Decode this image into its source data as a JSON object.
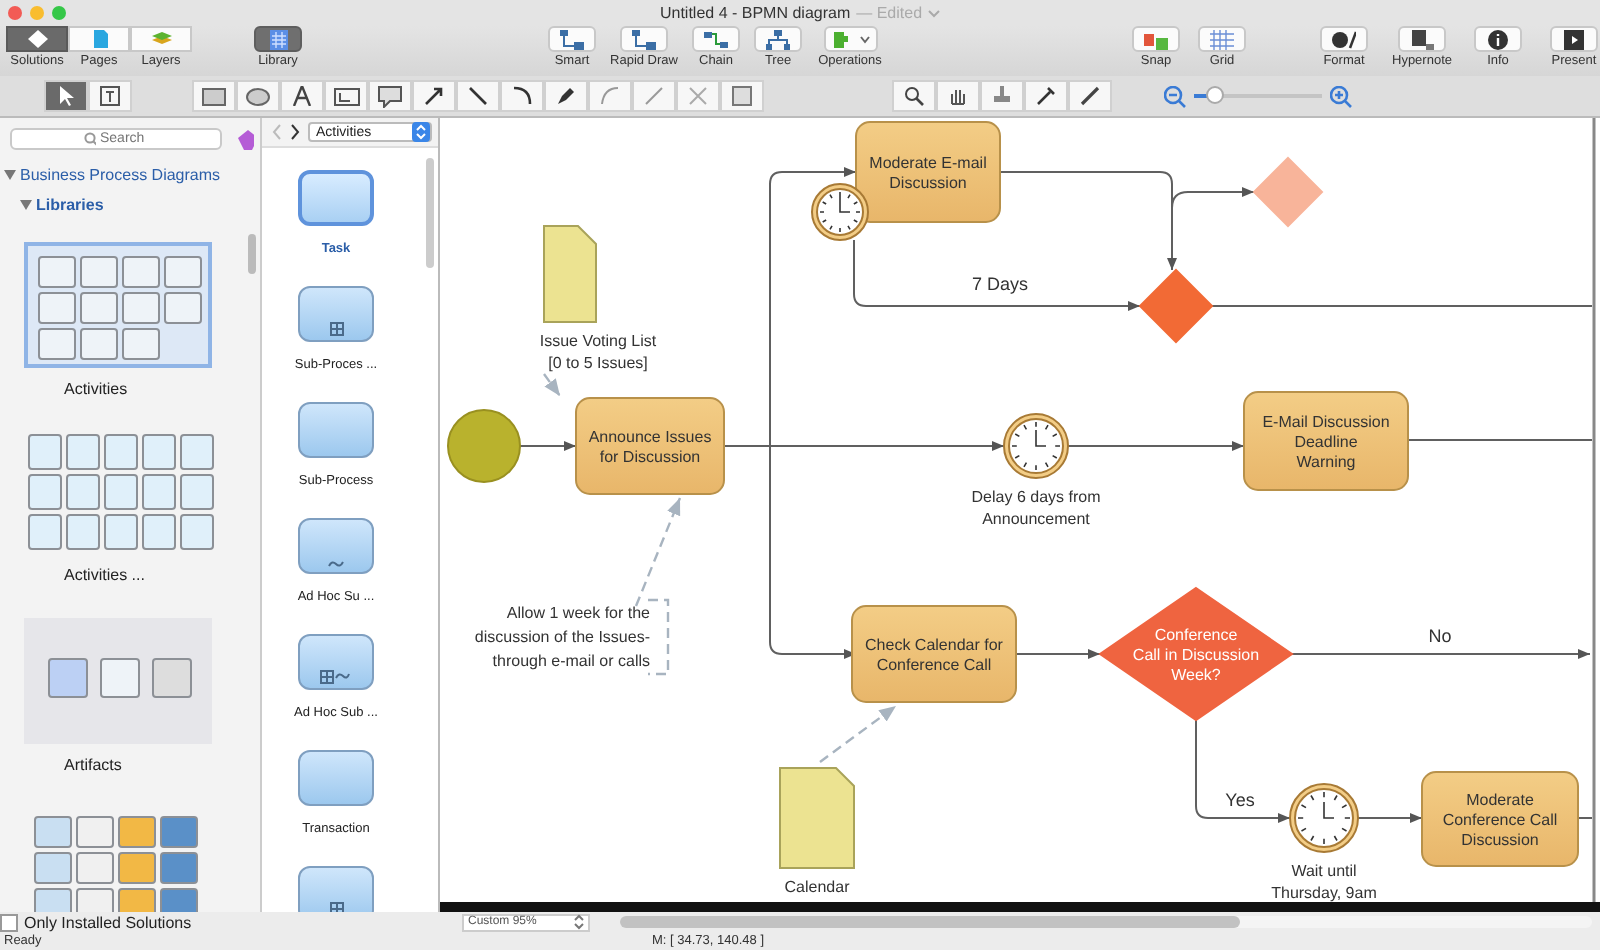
{
  "window": {
    "title": "Untitled 4 - BPMN diagram",
    "status": "— Edited"
  },
  "toolbar": {
    "view_tabs": [
      {
        "label": "Solutions",
        "selected": true
      },
      {
        "label": "Pages",
        "selected": false
      },
      {
        "label": "Layers",
        "selected": false
      }
    ],
    "library": {
      "label": "Library",
      "selected": true
    },
    "groups": [
      [
        {
          "label": "Smart"
        },
        {
          "label": "Rapid Draw"
        },
        {
          "label": "Chain"
        },
        {
          "label": "Tree"
        },
        {
          "label": "Operations",
          "menu": true
        }
      ],
      [
        {
          "label": "Snap"
        },
        {
          "label": "Grid"
        }
      ],
      [
        {
          "label": "Format"
        },
        {
          "label": "Hypernote"
        },
        {
          "label": "Info"
        },
        {
          "label": "Present"
        }
      ]
    ]
  },
  "tools": [
    {
      "kind": "pointer",
      "selected": true
    },
    {
      "kind": "text",
      "selected": false
    }
  ],
  "zoom_slider": {
    "level": 0.15
  },
  "sidebar": {
    "search": {
      "placeholder": "Search"
    },
    "tree": {
      "label": "Business Process Diagrams",
      "expanded": true,
      "children": [
        {
          "label": "Libraries",
          "expanded": true
        }
      ]
    },
    "libraries": [
      {
        "label": "Activities",
        "kind": "activities",
        "selected": true
      },
      {
        "label": "Activities ...",
        "kind": "activities2",
        "selected": false
      },
      {
        "label": "Artifacts",
        "kind": "artifacts",
        "selected": false
      },
      {
        "kind": "gallery",
        "selected": false
      }
    ],
    "only_installed": {
      "label": "Only Installed Solutions",
      "checked": false
    }
  },
  "library_panel": {
    "dropdown": "Activities",
    "shapes": [
      {
        "label": "Task",
        "kind": "plain",
        "selected": true
      },
      {
        "label": "Sub-Proces ...",
        "kind": "subprocess",
        "selected": false
      },
      {
        "label": "Sub-Process",
        "kind": "plain",
        "selected": false
      },
      {
        "label": "Ad Hoc Su ...",
        "kind": "adhoc",
        "selected": false
      },
      {
        "label": "Ad Hoc Sub ...",
        "kind": "adhoc-subprocess",
        "selected": false
      },
      {
        "label": "Transaction",
        "kind": "plain",
        "selected": false
      },
      {
        "kind": "subprocess",
        "selected": false
      }
    ]
  },
  "diagram": {
    "tasks": [
      {
        "label": "Moderate E-mail\nDiscussion",
        "boundary_timer": true
      },
      {
        "label": "Announce Issues\nfor Discussion",
        "boundary_timer": false
      },
      {
        "label": "E-Mail Discussion\nDeadline\nWarning",
        "boundary_timer": false
      },
      {
        "label": "Check Calendar for\nConference Call",
        "boundary_timer": false
      },
      {
        "label": "Moderate\nConference Call\nDiscussion",
        "boundary_timer": false
      }
    ],
    "timers": [
      {
        "label": "Delay 6 days from\nAnnouncement"
      },
      {
        "label": "Wait until\nThursday, 9am"
      }
    ],
    "documents": [
      {
        "label": "Issue Voting List\n[0 to 5 Issues]"
      },
      {
        "label": "Calendar"
      }
    ],
    "gateways": [
      {
        "color": "#f26a35"
      },
      {
        "color": "#f8b49a"
      },
      {
        "color": "#ef6440",
        "label": "Conference\nCall in Discussion\nWeek?"
      }
    ],
    "annotation": "Allow 1 week for the\ndiscussion of the Issues-\nthrough e-mail or calls",
    "flow_labels": [
      "7 Days",
      "No",
      "Yes"
    ]
  },
  "status_bar": {
    "zoom": "Custom 95%",
    "coordinates": "M: [ 34.73, 140.48 ]",
    "status": "Ready"
  }
}
